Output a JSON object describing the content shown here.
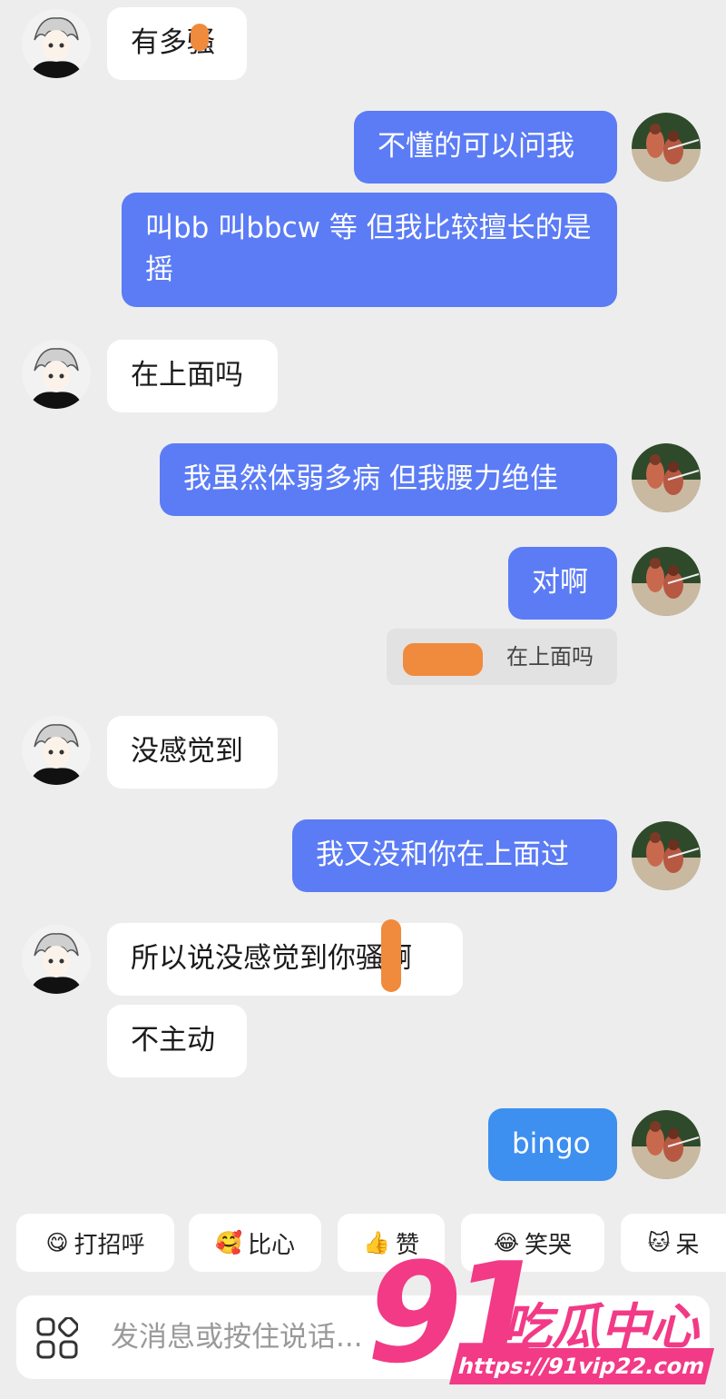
{
  "messages": [
    {
      "side": "left",
      "text": "有多骚"
    },
    {
      "side": "right",
      "text": "不懂的可以问我"
    },
    {
      "side": "right",
      "text": "叫bb 叫bbcw 等 但我比较擅长的是 摇"
    },
    {
      "side": "left",
      "text": "在上面吗"
    },
    {
      "side": "right",
      "text": "我虽然体弱多病 但我腰力绝佳"
    },
    {
      "side": "right",
      "text": "对啊"
    },
    {
      "side": "quote",
      "text": "在上面吗"
    },
    {
      "side": "left",
      "text": "没感觉到"
    },
    {
      "side": "right",
      "text": "我又没和你在上面过"
    },
    {
      "side": "left",
      "text": "所以说没感觉到你骚啊"
    },
    {
      "side": "left",
      "text": "不主动"
    },
    {
      "side": "right",
      "text": "bingo"
    }
  ],
  "quick_replies": [
    {
      "icon": "😋",
      "label": "打招呼"
    },
    {
      "icon": "🥰",
      "label": "比心"
    },
    {
      "icon": "👍",
      "label": "赞"
    },
    {
      "icon": "😂",
      "label": "笑哭"
    },
    {
      "icon": "🐱",
      "label": "呆"
    }
  ],
  "input": {
    "placeholder": "发消息或按住说话..."
  },
  "watermark": {
    "number": "91",
    "name": "吃瓜中心",
    "url": "https://91vip22.com"
  },
  "colors": {
    "sent": "#5b7cf5",
    "sent_alt": "#3d8ff0",
    "received": "#ffffff",
    "background": "#ededed",
    "watermark": "#f23a86"
  }
}
